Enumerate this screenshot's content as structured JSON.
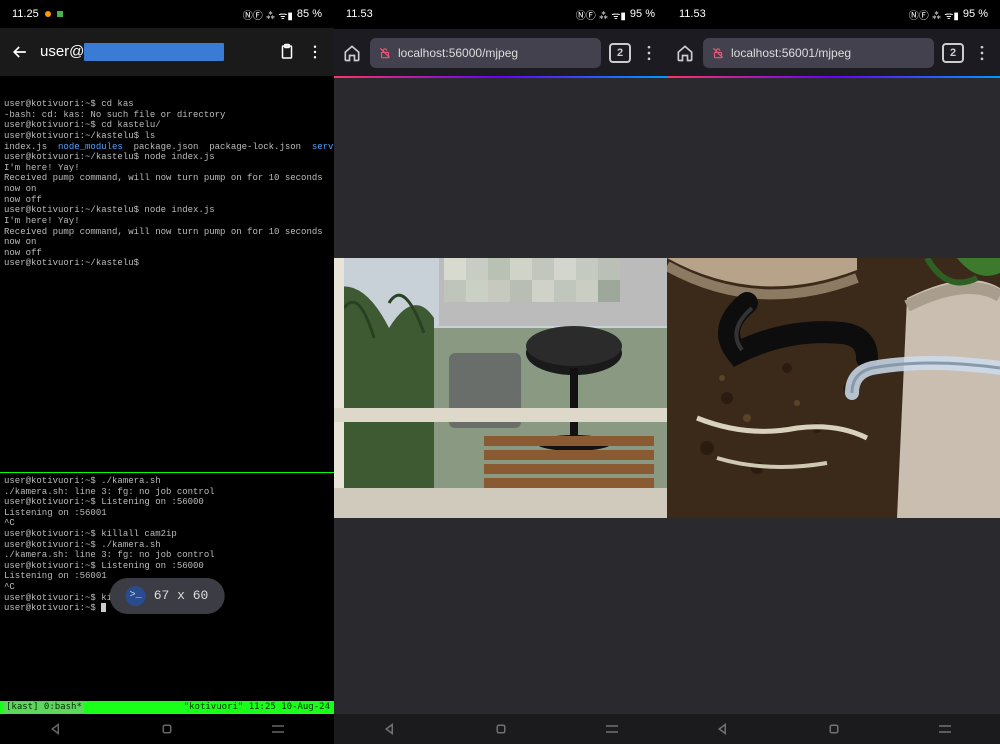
{
  "phones": {
    "p1": {
      "time": "11.25",
      "battery": "85 %",
      "header_user_prefix": "user@",
      "terminal_pane1": [
        "user@kotivuori:~$ cd kas",
        "-bash: cd: kas: No such file or directory",
        "user@kotivuori:~$ cd kastelu/",
        "user@kotivuori:~/kastelu$ ls",
        "index.js  node_modules  package.json  package-lock.json  server",
        "user@kotivuori:~/kastelu$ node index.js",
        "I'm here! Yay!",
        "Received pump command, will now turn pump on for 10 seconds",
        "now on",
        "now off",
        "user@kotivuori:~/kastelu$ node index.js",
        "I'm here! Yay!",
        "Received pump command, will now turn pump on for 10 seconds",
        "now on",
        "now off",
        "user@kotivuori:~/kastelu$"
      ],
      "terminal_pane2": [
        "user@kotivuori:~$ ./kamera.sh",
        "./kamera.sh: line 3: fg: no job control",
        "user@kotivuori:~$ Listening on :56000",
        "Listening on :56001",
        "^C",
        "user@kotivuori:~$ killall cam2ip",
        "user@kotivuori:~$ ./kamera.sh",
        "./kamera.sh: line 3: fg: no job control",
        "user@kotivuori:~$ Listening on :56000",
        "Listening on :56001",
        "^C",
        "user@kotivuori:~$ killall cam2ip",
        "user@kotivuori:~$ "
      ],
      "tmux_left": "[kast] 0:bash*",
      "tmux_right": "\"kotivuori\" 11:25 10-Aug-24",
      "dims": "67 x 60"
    },
    "p2": {
      "time": "11.53",
      "battery": "95 %",
      "url": "localhost:56000/mjpeg",
      "tabs": "2"
    },
    "p3": {
      "time": "11.53",
      "battery": "95 %",
      "url": "localhost:56001/mjpeg",
      "tabs": "2"
    }
  },
  "icons": {
    "status_glyphs": "ⓃⒻ ⁂ ᯤ▮"
  }
}
